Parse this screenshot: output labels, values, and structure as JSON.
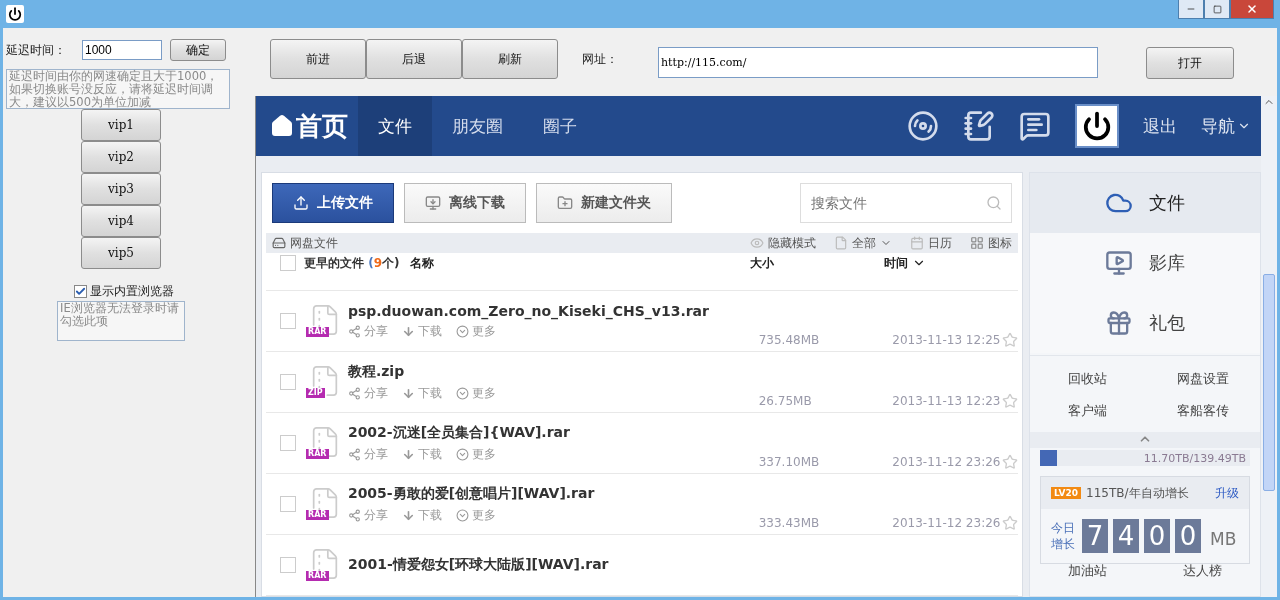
{
  "delay": {
    "label": "延迟时间：",
    "value": "1000",
    "confirm": "确定",
    "hint": "延迟时间由你的网速确定且大于1000，如果切换账号没反应，请将延迟时间调大，建议以500为单位加减"
  },
  "vip_buttons": [
    "vip1",
    "vip2",
    "vip3",
    "vip4",
    "vip5"
  ],
  "builtin_browser": {
    "label": "显示内置浏览器",
    "checked": true,
    "hint": "IE浏览器无法登录时请勾选此项"
  },
  "nav_buttons": [
    "前进",
    "后退",
    "刷新"
  ],
  "address": {
    "label": "网址：",
    "value": "http://115.com/",
    "open": "打开"
  },
  "site": {
    "logo": "首页",
    "tabs": [
      {
        "label": "文件",
        "selected": true
      },
      {
        "label": "朋友圈",
        "selected": false
      },
      {
        "label": "圈子",
        "selected": false
      }
    ],
    "logout": "退出",
    "menu": "导航",
    "actions": [
      {
        "kind": "upload",
        "label": "上传文件"
      },
      {
        "kind": "offline",
        "label": "离线下载"
      },
      {
        "kind": "folder",
        "label": "新建文件夹"
      }
    ],
    "search": {
      "placeholder": "搜索文件"
    },
    "breadcrumb": "网盘文件",
    "view_options": [
      {
        "kind": "eye",
        "label": "隐藏模式",
        "dropdown": false
      },
      {
        "kind": "file",
        "label": "全部",
        "dropdown": true
      },
      {
        "kind": "calendar",
        "label": "日历",
        "dropdown": false
      },
      {
        "kind": "grid",
        "label": "图标",
        "dropdown": false
      }
    ],
    "group": {
      "label": "更早的文件",
      "count_before": "(",
      "count": "9",
      "count_after": "个)",
      "checked": false
    },
    "columns": [
      "名称",
      "大小",
      "时间"
    ],
    "files": [
      {
        "name": "psp.duowan.com_Zero_no_Kiseki_CHS_v13.rar",
        "type": "RAR",
        "checked": false,
        "actions": [
          "分享",
          "下载",
          "更多"
        ],
        "size": "735.48MB",
        "time": "2013-11-13 12:25"
      },
      {
        "name": "教程.zip",
        "type": "ZIP",
        "checked": false,
        "actions": [
          "分享",
          "下载",
          "更多"
        ],
        "size": "26.75MB",
        "time": "2013-11-13 12:23"
      },
      {
        "name": "2002-沉迷[全员集合]{WAV].rar",
        "type": "RAR",
        "checked": false,
        "actions": [
          "分享",
          "下载",
          "更多"
        ],
        "size": "337.10MB",
        "time": "2013-11-12 23:26"
      },
      {
        "name": "2005-勇敢的爱[创意唱片][WAV].rar",
        "type": "RAR",
        "checked": false,
        "actions": [
          "分享",
          "下载",
          "更多"
        ],
        "size": "333.43MB",
        "time": "2013-11-12 23:26"
      },
      {
        "name": "2001-情爱怨女[环球大陆版][WAV].rar",
        "type": "RAR",
        "checked": false
      }
    ],
    "sidebar": {
      "items": [
        {
          "kind": "file",
          "label": "文件",
          "selected": true
        },
        {
          "kind": "video",
          "label": "影库",
          "selected": false
        },
        {
          "kind": "gift",
          "label": "礼包",
          "selected": false
        }
      ],
      "links": [
        "回收站",
        "网盘设置",
        "客户端",
        "客船客传"
      ],
      "storage": {
        "level": 0.08,
        "reading": "11.70TB/139.49TB"
      },
      "growth": {
        "badge": "LV20",
        "text": "115TB/年自动增长",
        "upgrade": "升级",
        "label": "今日增长",
        "digits": [
          "7",
          "4",
          "0",
          "0"
        ],
        "unit": "MB"
      },
      "bottom_links": [
        "加油站",
        "达人榜"
      ]
    }
  }
}
